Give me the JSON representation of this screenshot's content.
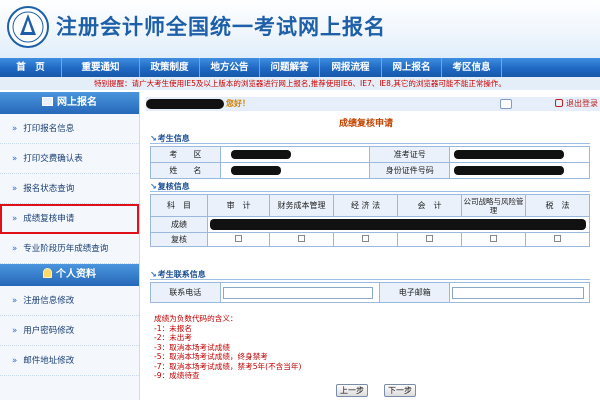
{
  "header": {
    "title": "注册会计师全国统一考试网上报名"
  },
  "nav": {
    "items": [
      "首　页",
      "重要通知",
      "政策制度",
      "地方公告",
      "问题解答",
      "网报流程",
      "网上报名",
      "考区信息"
    ]
  },
  "notice": {
    "text": "特别提醒：请广大考生使用IE5及以上版本的浏览器进行网上报名,推荐使用IE6、IE7、IE8,其它的浏览器可能不能正常操作。"
  },
  "sidebar": {
    "online_heading": "网上报名",
    "online_items": [
      "打印报名信息",
      "打印交费确认表",
      "报名状态查询",
      "成绩复核申请",
      "专业阶段历年成绩查询"
    ],
    "personal_heading": "个人资料",
    "personal_items": [
      "注册信息修改",
      "用户密码修改",
      "邮件地址修改"
    ]
  },
  "main": {
    "greeting": "您好！",
    "logout": "退出登录",
    "form_title": "成绩复核申请",
    "candidate": {
      "section": "考生信息",
      "area_label": "考　　区",
      "ticket_label": "准考证号",
      "name_label": "姓　　名",
      "id_label": "身份证件号码"
    },
    "scores": {
      "section": "复核信息",
      "subject_label": "科　目",
      "score_label": "成绩",
      "review_label": "复核",
      "subjects": [
        "审　计",
        "财务成本管理",
        "经 济 法",
        "会　计",
        "公司战略与风险管理",
        "税　法"
      ]
    },
    "contact": {
      "section": "考生联系信息",
      "phone_label": "联系电话",
      "email_label": "电子邮箱"
    },
    "legend": {
      "title": "成绩为负数代码的含义：",
      "lines": [
        "-1：未报名",
        "-2：未出考",
        "-3：取消本场考试成绩",
        "-5：取消本场考试成绩，终身禁考",
        "-7：取消本场考试成绩，禁考5年(不含当年)",
        "-9：成绩待查"
      ]
    },
    "buttons": {
      "prev": "上一步",
      "next": "下一步"
    }
  }
}
